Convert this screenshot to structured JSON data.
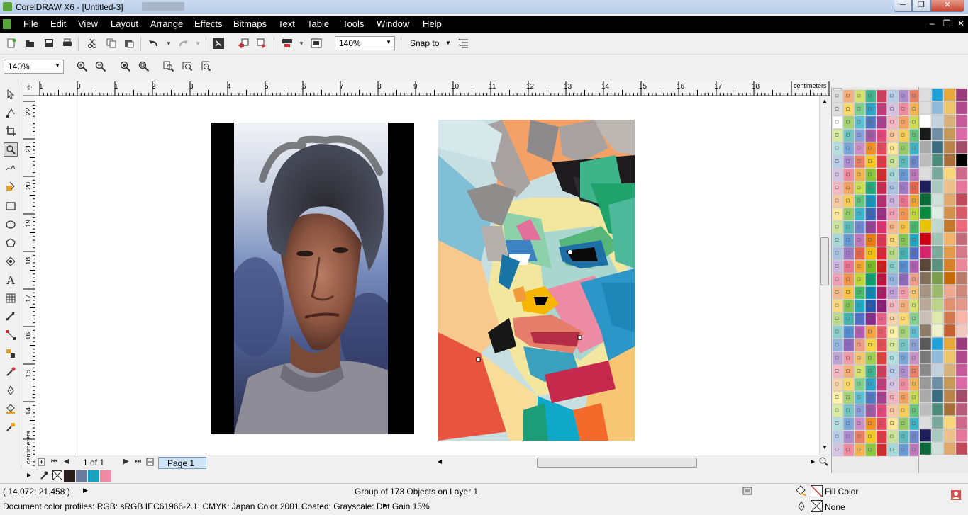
{
  "window": {
    "title": "CorelDRAW X6 - [Untitled-3]",
    "minimize": "─",
    "maximize": "❐",
    "close": "✕"
  },
  "menu": {
    "items": [
      "File",
      "Edit",
      "View",
      "Layout",
      "Arrange",
      "Effects",
      "Bitmaps",
      "Text",
      "Table",
      "Tools",
      "Window",
      "Help"
    ],
    "mdi_controls": [
      "–",
      "❐",
      "✕"
    ]
  },
  "toolbar": {
    "zoom_value": "140%",
    "snap_label": "Snap to",
    "icons": [
      "new-icon",
      "open-icon",
      "save-icon",
      "print-icon",
      "cut-icon",
      "copy-icon",
      "paste-icon",
      "undo-icon",
      "redo-icon",
      "search-content-icon",
      "import-icon",
      "export-icon",
      "application-launcher-icon",
      "welcome-screen-icon",
      "options-icon"
    ]
  },
  "zoom_toolbar": {
    "zoom_value": "140%",
    "icons": [
      "zoom-in-icon",
      "zoom-out-icon",
      "zoom-selected-icon",
      "zoom-all-icon",
      "zoom-page-icon",
      "zoom-width-icon",
      "zoom-height-icon"
    ]
  },
  "toolbox": {
    "tools": [
      "pick-tool-icon",
      "shape-tool-icon",
      "crop-tool-icon",
      "zoom-tool-icon",
      "freehand-tool-icon",
      "smart-fill-icon",
      "rectangle-tool-icon",
      "ellipse-tool-icon",
      "polygon-tool-icon",
      "basic-shapes-icon",
      "text-tool-icon",
      "table-tool-icon",
      "dimension-tool-icon",
      "connector-tool-icon",
      "blend-tool-icon",
      "color-eyedropper-icon",
      "outline-pen-icon",
      "fill-tool-icon",
      "interactive-fill-icon"
    ]
  },
  "ruler": {
    "unit": "centimeters",
    "top_labels": [
      "1",
      "0",
      "1",
      "2",
      "3",
      "4",
      "5",
      "6",
      "7",
      "8",
      "9",
      "10",
      "11",
      "12",
      "13",
      "14",
      "15",
      "16",
      "17",
      "18"
    ],
    "left_labels": [
      "22",
      "21",
      "20",
      "19",
      "18",
      "17",
      "16",
      "15",
      "14"
    ]
  },
  "page_nav": {
    "page_count": "1 of 1",
    "page_tab": "Page 1"
  },
  "status": {
    "coordinates": "( 14.072; 21.458 )",
    "selection_info": "Group of 173 Objects on Layer 1",
    "color_profiles": "Document color profiles: RGB: sRGB IEC61966-2.1; CMYK: Japan Color 2001 Coated; Grayscale: Dot Gain 15%",
    "fill_label": "Fill Color",
    "outline_label": "None"
  },
  "colors": {
    "menubar_bg": "#000000",
    "page_tab_bg": "#cfe4f6",
    "close_btn": "#c6432e"
  }
}
